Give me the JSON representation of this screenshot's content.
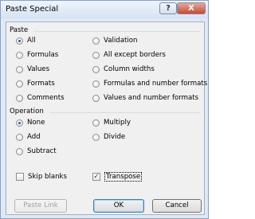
{
  "window": {
    "title": "Paste Special",
    "help_label": "?",
    "close_label": "X"
  },
  "paste": {
    "label": "Paste",
    "options": [
      {
        "label": "All",
        "selected": true
      },
      {
        "label": "Formulas",
        "selected": false
      },
      {
        "label": "Values",
        "selected": false
      },
      {
        "label": "Formats",
        "selected": false
      },
      {
        "label": "Comments",
        "selected": false
      },
      {
        "label": "Validation",
        "selected": false
      },
      {
        "label": "All except borders",
        "selected": false
      },
      {
        "label": "Column widths",
        "selected": false
      },
      {
        "label": "Formulas and number formats",
        "selected": false
      },
      {
        "label": "Values and number formats",
        "selected": false
      }
    ]
  },
  "operation": {
    "label": "Operation",
    "options": [
      {
        "label": "None",
        "selected": true
      },
      {
        "label": "Add",
        "selected": false
      },
      {
        "label": "Subtract",
        "selected": false
      },
      {
        "label": "Multiply",
        "selected": false
      },
      {
        "label": "Divide",
        "selected": false
      }
    ]
  },
  "checkboxes": {
    "skip_blanks": {
      "label": "Skip blanks",
      "checked": false
    },
    "transpose": {
      "label": "Transpose",
      "checked": true,
      "mark": "✓"
    }
  },
  "buttons": {
    "paste_link": "Paste Link",
    "ok": "OK",
    "cancel": "Cancel"
  }
}
